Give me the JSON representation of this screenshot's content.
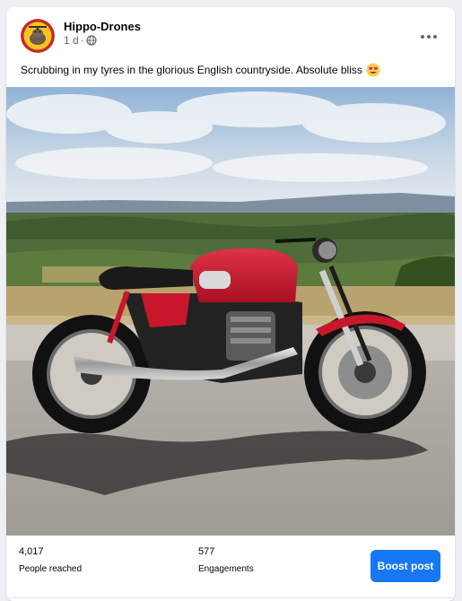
{
  "post": {
    "page_name": "Hippo-Drones",
    "time": "1 d",
    "separator": "·",
    "privacy_icon": "globe-icon",
    "more_icon": "ellipsis-icon",
    "text": "Scrubbing in my tyres in the glorious English countryside. Absolute bliss",
    "emoji_icon": "heart-eyes-emoji-icon",
    "photo_subject": "red cafe racer motorcycle on hilltop overlooking countryside"
  },
  "stats": {
    "reached_value": "4,017",
    "reached_label": "People reached",
    "engagements_value": "577",
    "engagements_label": "Engagements"
  },
  "actions": {
    "boost_label": "Boost post"
  },
  "colors": {
    "accent": "#1877f2",
    "muted_text": "#65676b",
    "background": "#eef0f3",
    "bike_red": "#c8172b"
  }
}
